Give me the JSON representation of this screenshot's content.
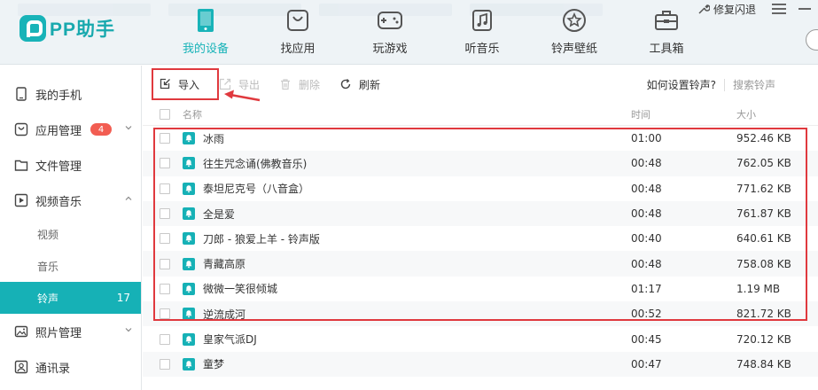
{
  "app": {
    "logo_text": "PP助手"
  },
  "topbar": {
    "fix_label": "修复闪退"
  },
  "nav": [
    {
      "label": "我的设备",
      "icon": "phone-icon",
      "active": true
    },
    {
      "label": "找应用",
      "icon": "app-bag-icon",
      "active": false
    },
    {
      "label": "玩游戏",
      "icon": "gamepad-icon",
      "active": false
    },
    {
      "label": "听音乐",
      "icon": "music-icon",
      "active": false
    },
    {
      "label": "铃声壁纸",
      "icon": "star-icon",
      "active": false
    },
    {
      "label": "工具箱",
      "icon": "toolbox-icon",
      "active": false
    }
  ],
  "sidebar": {
    "my_phone": "我的手机",
    "app_manage": "应用管理",
    "app_badge": "4",
    "file_manage": "文件管理",
    "video_music": "视频音乐",
    "sub_video": "视频",
    "sub_music": "音乐",
    "sub_ringtone": "铃声",
    "ringtone_count": "17",
    "photo_manage": "照片管理",
    "contacts": "通讯录"
  },
  "toolbar": {
    "import": "导入",
    "export": "导出",
    "delete": "删除",
    "refresh": "刷新",
    "how_to": "如何设置铃声?",
    "search_placeholder": "搜索铃声"
  },
  "table": {
    "columns": {
      "name": "名称",
      "time": "时间",
      "size": "大小"
    },
    "rows": [
      {
        "name": "冰雨",
        "time": "01:00",
        "size": "952.46 KB"
      },
      {
        "name": "往生咒念诵(佛教音乐)",
        "time": "00:48",
        "size": "762.05 KB"
      },
      {
        "name": "泰坦尼克号（八音盒）",
        "time": "00:48",
        "size": "771.62 KB"
      },
      {
        "name": "全是爱",
        "time": "00:48",
        "size": "761.87 KB"
      },
      {
        "name": "刀郎 - 狼爱上羊 - 铃声版",
        "time": "00:40",
        "size": "640.61 KB"
      },
      {
        "name": "青藏高原",
        "time": "00:48",
        "size": "758.08 KB"
      },
      {
        "name": "微微一笑很倾城",
        "time": "01:17",
        "size": "1.19 MB"
      },
      {
        "name": "逆流成河",
        "time": "00:52",
        "size": "821.72 KB"
      },
      {
        "name": "皇家气派DJ",
        "time": "00:45",
        "size": "720.12 KB"
      },
      {
        "name": "童梦",
        "time": "00:47",
        "size": "748.84 KB"
      }
    ]
  },
  "colors": {
    "accent": "#16b1b6",
    "highlight": "#e0393e",
    "badge": "#f25d52"
  }
}
